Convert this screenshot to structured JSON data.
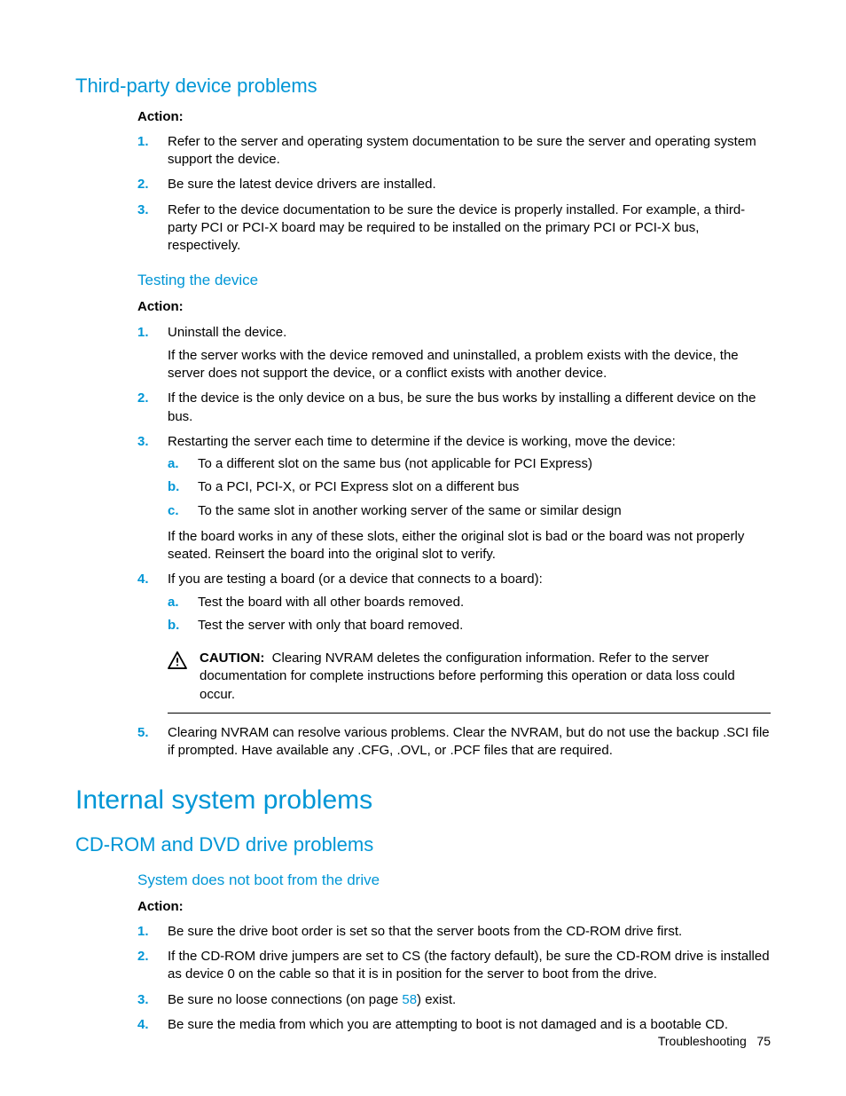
{
  "section1": {
    "title": "Third-party device problems",
    "action": "Action:",
    "items": [
      "Refer to the server and operating system documentation to be sure the server and operating system support the device.",
      "Be sure the latest device drivers are installed.",
      "Refer to the device documentation to be sure the device is properly installed. For example, a third-party PCI or PCI-X board may be required to be installed on the primary PCI or PCI-X bus, respectively."
    ],
    "sub": {
      "title": "Testing the device",
      "action": "Action:",
      "i1": "Uninstall the device.",
      "i1_after": "If the server works with the device removed and uninstalled, a problem exists with the device, the server does not support the device, or a conflict exists with another device.",
      "i2": "If the device is the only device on a bus, be sure the bus works by installing a different device on the bus.",
      "i3": "Restarting the server each time to determine if the device is working, move the device:",
      "i3_sub": [
        "To a different slot on the same bus (not applicable for PCI Express)",
        "To a PCI, PCI-X, or PCI Express slot on a different bus",
        "To the same slot in another working server of the same or similar design"
      ],
      "i3_after": "If the board works in any of these slots, either the original slot is bad or the board was not properly seated. Reinsert the board into the original slot to verify.",
      "i4": "If you are testing a board (or a device that connects to a board):",
      "i4_sub": [
        "Test the board with all other boards removed.",
        "Test the server with only that board removed."
      ],
      "caution_label": "CAUTION:",
      "caution_text": "Clearing NVRAM deletes the configuration information. Refer to the server documentation for complete instructions before performing this operation or data loss could occur.",
      "i5": "Clearing NVRAM can resolve various problems. Clear the NVRAM, but do not use the backup .SCI file if prompted. Have available any .CFG, .OVL, or .PCF files that are required."
    }
  },
  "section2": {
    "title": "Internal system problems",
    "sub_title": "CD-ROM and DVD drive problems",
    "subsub_title": "System does not boot from the drive",
    "action": "Action:",
    "i1": "Be sure the drive boot order is set so that the server boots from the CD-ROM drive first.",
    "i2": "If the CD-ROM drive jumpers are set to CS (the factory default), be sure the CD-ROM drive is installed as device 0 on the cable so that it is in position for the server to boot from the drive.",
    "i3_pre": "Be sure no loose connections (on page ",
    "i3_link": "58",
    "i3_post": ") exist.",
    "i4": "Be sure the media from which you are attempting to boot is not damaged and is a bootable CD."
  },
  "footer": {
    "section": "Troubleshooting",
    "page": "75"
  }
}
